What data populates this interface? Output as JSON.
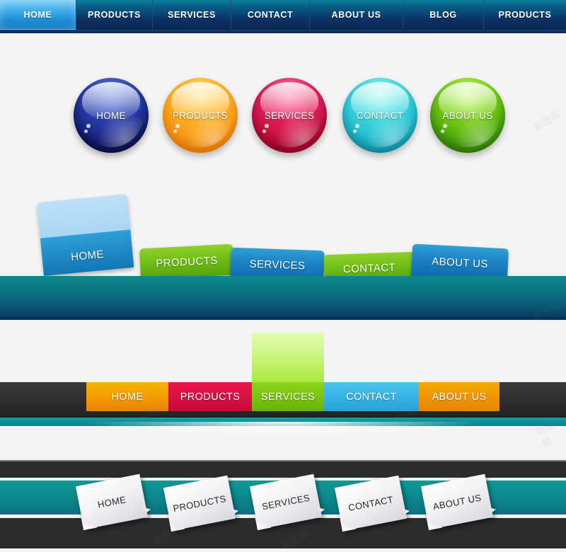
{
  "page": {
    "background_color": "#f4f4f5",
    "watermark_text": "新图网"
  },
  "top_navbar": {
    "name": "top-navigation-bar",
    "active_index": 0,
    "active_color": "#4fb4ee",
    "base_color": "#0c2f63",
    "items": [
      {
        "label": "HOME",
        "active": true
      },
      {
        "label": "PRODUCTS",
        "active": false
      },
      {
        "label": "SERVICES",
        "active": false
      },
      {
        "label": "CONTACT",
        "active": false
      },
      {
        "label": "ABOUT US",
        "active": false
      },
      {
        "label": "BLOG",
        "active": false
      },
      {
        "label": "PRODUCTS",
        "active": false
      }
    ]
  },
  "orb_buttons": {
    "name": "glossy-orb-button-row",
    "items": [
      {
        "label": "HOME",
        "color": "#2a3fae"
      },
      {
        "label": "PRODUCTS",
        "color": "#ffb525"
      },
      {
        "label": "SERVICES",
        "color": "#e8215f"
      },
      {
        "label": "CONTACT",
        "color": "#3fdbe0"
      },
      {
        "label": "ABOUT US",
        "color": "#7fd416"
      }
    ]
  },
  "ribbon_tabs": {
    "name": "tilted-ribbon-tab-bar",
    "bar_color": "#0a7a84",
    "active_index": 0,
    "items": [
      {
        "label": "HOME",
        "color": "#2f9fd6",
        "active": true
      },
      {
        "label": "PRODUCTS",
        "color": "#6fbf17",
        "active": false
      },
      {
        "label": "SERVICES",
        "color": "#1c82c4",
        "active": false
      },
      {
        "label": "CONTACT",
        "color": "#6fbf17",
        "active": false
      },
      {
        "label": "ABOUT US",
        "color": "#1c82c4",
        "active": false
      }
    ]
  },
  "dark_bar_tabs": {
    "name": "dark-bar-tab-row",
    "bar_color": "#2e2e2e",
    "strip_color": "#12a0a4",
    "active_index": 2,
    "items": [
      {
        "label": "HOME",
        "color": "#f49a00",
        "active": false
      },
      {
        "label": "PRODUCTS",
        "color": "#d90f42",
        "active": false
      },
      {
        "label": "SERVICES",
        "color": "#78c40d",
        "active": true
      },
      {
        "label": "CONTACT",
        "color": "#35b2e4",
        "active": false
      },
      {
        "label": "ABOUT US",
        "color": "#f09400",
        "active": false
      }
    ]
  },
  "paper_tabs": {
    "name": "paper-note-tab-row",
    "band_color": "#0d8a8d",
    "background_color": "#2c2c2c",
    "note_color": "#f3f2f4",
    "items": [
      {
        "label": "HOME"
      },
      {
        "label": "PRODUCTS"
      },
      {
        "label": "SERVICES"
      },
      {
        "label": "CONTACT"
      },
      {
        "label": "ABOUT US"
      }
    ]
  }
}
